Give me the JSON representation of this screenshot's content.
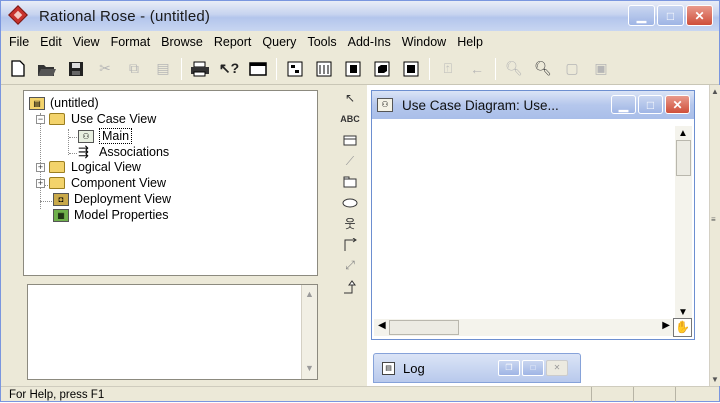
{
  "window": {
    "title": "Rational Rose - (untitled)"
  },
  "menu": [
    {
      "label": "File"
    },
    {
      "label": "Edit"
    },
    {
      "label": "View"
    },
    {
      "label": "Format"
    },
    {
      "label": "Browse"
    },
    {
      "label": "Report"
    },
    {
      "label": "Query"
    },
    {
      "label": "Tools"
    },
    {
      "label": "Add-Ins"
    },
    {
      "label": "Window"
    },
    {
      "label": "Help"
    }
  ],
  "toolbar": {
    "icons": [
      "new-icon",
      "open-icon",
      "save-icon",
      "cut-icon",
      "copy-icon",
      "paste-icon",
      "print-icon",
      "context-help-icon",
      "view-doc-icon",
      "browse-class-diagram-icon",
      "browse-interaction-diagram-icon",
      "browse-component-diagram-icon",
      "browse-deployment-diagram-icon",
      "browse-parent-icon",
      "browse-previous-icon",
      "zoom-in-icon",
      "zoom-out-icon",
      "fit-in-window-icon",
      "undo-fit-icon"
    ]
  },
  "tree": {
    "root": "(untitled)",
    "use_case_view": "Use Case View",
    "main": "Main",
    "associations": "Associations",
    "logical_view": "Logical View",
    "component_view": "Component View",
    "deployment_view": "Deployment View",
    "model_properties": "Model Properties"
  },
  "toolbox": {
    "abc_label": "ABC",
    "tools": [
      "selection-tool-icon",
      "text-box-tool-icon",
      "note-tool-icon",
      "anchor-note-tool-icon",
      "package-tool-icon",
      "use-case-tool-icon",
      "actor-tool-icon",
      "unidirectional-association-tool-icon",
      "dependency-tool-icon",
      "generalization-tool-icon"
    ]
  },
  "diagram_window": {
    "title": "Use Case Diagram: Use..."
  },
  "log_window": {
    "title": "Log"
  },
  "status": {
    "text": "For Help, press F1"
  }
}
